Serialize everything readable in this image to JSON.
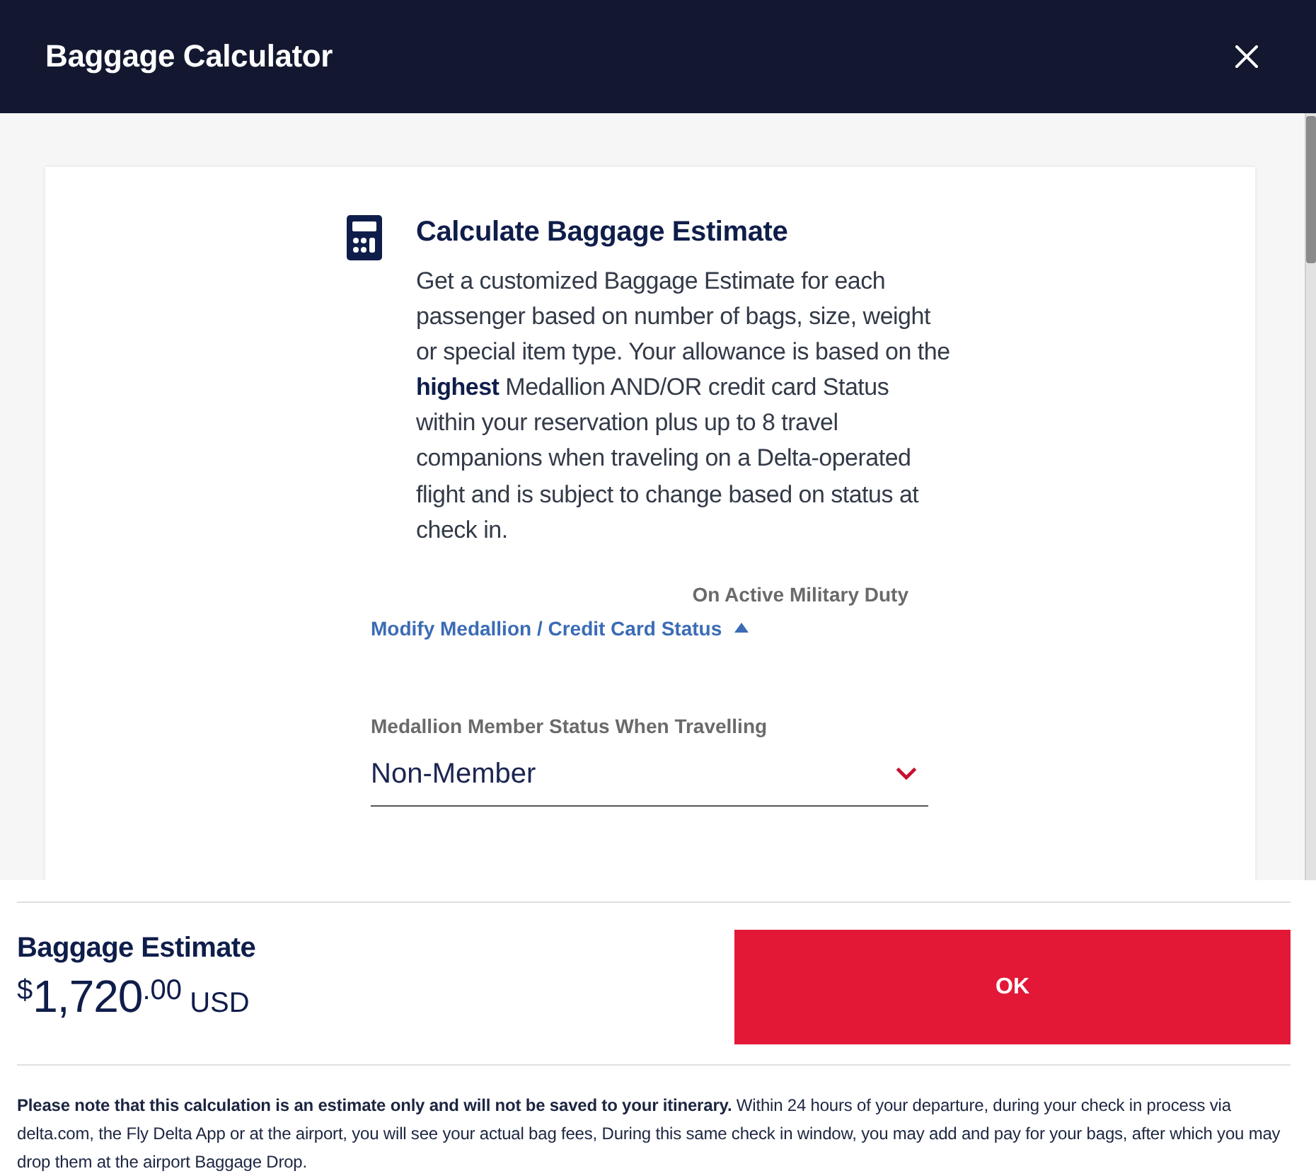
{
  "dialog": {
    "title": "Baggage Calculator"
  },
  "intro": {
    "heading": "Calculate Baggage Estimate",
    "text": "Get a customized Baggage Estimate for each passenger based on number of bags, size, weight or special item type. Your allowance is based on the **highest** Medallion AND/OR credit card Status within your reservation plus up to 8 travel companions when traveling on a Delta-operated flight and is subject to change based on status at check in."
  },
  "military_duty": {
    "label": "On Active Military Duty"
  },
  "modify_status": {
    "label": "Modify Medallion / Credit Card Status",
    "expanded": true
  },
  "medallion_status": {
    "label": "Medallion Member Status When Travelling",
    "value": "Non-Member"
  },
  "estimate": {
    "title": "Baggage Estimate",
    "amount": {
      "symbol": "$",
      "whole": "1,720",
      "cents": ".00",
      "currency": "USD"
    }
  },
  "ok_button": {
    "label": "OK"
  },
  "note": "**Please note that this calculation is an estimate only and will not be saved to your itinerary.** Within 24 hours of your departure, during your check in process via delta.com, the Fly Delta App or at the airport, you will see your actual bag fees, During this same check in window, you may add and pay for your bags, after which you may drop them at the airport Baggage Drop."
}
